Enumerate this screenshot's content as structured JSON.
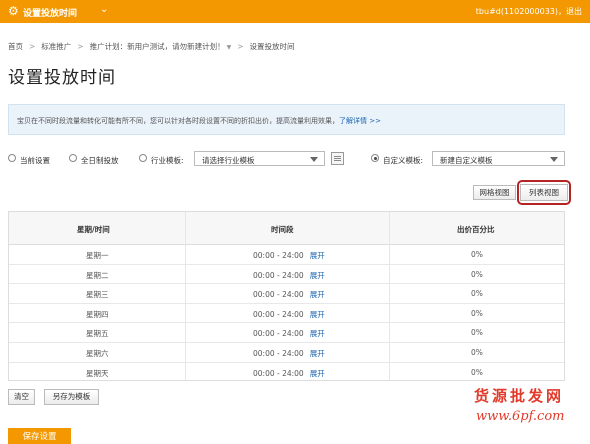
{
  "topbar": {
    "title": "设置投放时间",
    "icon": "gear-icon",
    "caret": "⌄",
    "user": "tbu#d(1102000033)，退出"
  },
  "breadcrumb": {
    "home": "首页",
    "standard": "标准推广",
    "plan": "推广计划：新用户测试，请勿新建计划！",
    "current": "设置投放时间"
  },
  "page_title": "设置投放时间",
  "notice": {
    "text": "宝贝在不同时段流量和转化可能有所不同，您可以针对各时段设置不同的折扣出价，提高流量利用效果，",
    "link": "了解详情 >>"
  },
  "options": {
    "current": "当前设置",
    "allday": "全日制投放",
    "industry": "行业模板:",
    "industry_select": "请选择行业模板",
    "custom": "自定义模板:",
    "custom_select": "新建自定义模板",
    "selected": "custom"
  },
  "views": {
    "grid": "网格视图",
    "list": "列表视图"
  },
  "table": {
    "headers": [
      "星期/时间",
      "时间段",
      "出价百分比"
    ],
    "expand": "展开",
    "rows": [
      {
        "day": "星期一",
        "time": "00:00 - 24:00",
        "pct": "0%"
      },
      {
        "day": "星期二",
        "time": "00:00 - 24:00",
        "pct": "0%"
      },
      {
        "day": "星期三",
        "time": "00:00 - 24:00",
        "pct": "0%"
      },
      {
        "day": "星期四",
        "time": "00:00 - 24:00",
        "pct": "0%"
      },
      {
        "day": "星期五",
        "time": "00:00 - 24:00",
        "pct": "0%"
      },
      {
        "day": "星期六",
        "time": "00:00 - 24:00",
        "pct": "0%"
      },
      {
        "day": "星期天",
        "time": "00:00 - 24:00",
        "pct": "0%"
      }
    ]
  },
  "actions": {
    "clear": "清空",
    "save_template": "另存为模板",
    "save_settings": "保存设置"
  },
  "watermark": {
    "line1": "货源批发网",
    "line2": "www.6pf.com"
  },
  "colors": {
    "accent": "#f39800",
    "link": "#1a63b0",
    "highlight": "#b32424"
  }
}
